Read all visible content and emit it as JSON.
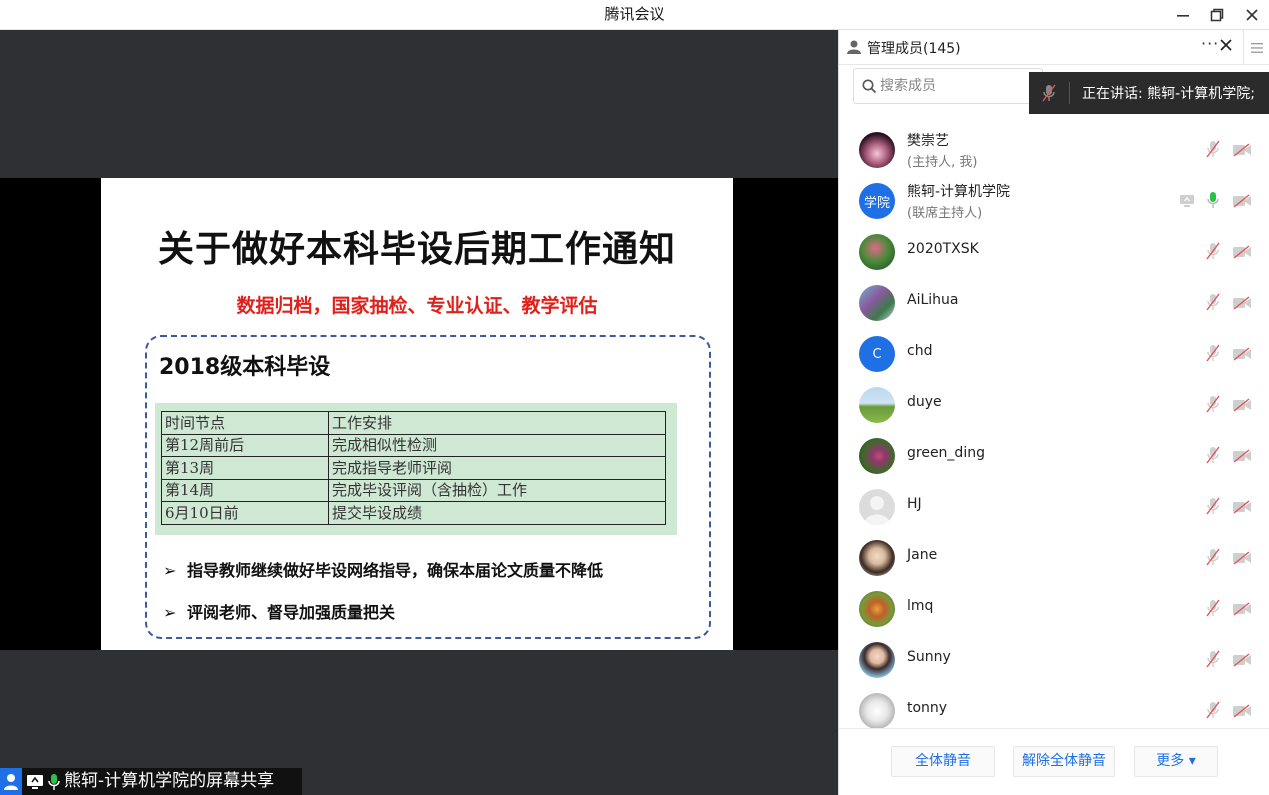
{
  "window": {
    "title": "腾讯会议"
  },
  "slide": {
    "title": "关于做好本科毕设后期工作通知",
    "subtitle": "数据归档，国家抽检、专业认证、教学评估",
    "box_title": "2018级本科毕设",
    "table": {
      "headers": [
        "时间节点",
        "工作安排"
      ],
      "rows": [
        [
          "第12周前后",
          "完成相似性检测"
        ],
        [
          "第13周",
          "完成指导老师评阅"
        ],
        [
          "第14周",
          "完成毕设评阅（含抽检）工作"
        ],
        [
          "6月10日前",
          "提交毕设成绩"
        ]
      ]
    },
    "bullets": [
      "指导教师继续做好毕设网络指导，确保本届论文质量不降低",
      "评阅老师、督导加强质量把关"
    ],
    "bullet_symbol": "➢"
  },
  "share": {
    "label": "熊轲-计算机学院的屏幕共享"
  },
  "panel": {
    "title": "管理成员(145)",
    "more_label": "···",
    "search_placeholder": "搜索成员",
    "speaking": "正在讲话: 熊轲-计算机学院;",
    "members": [
      {
        "name": "樊崇艺",
        "role": "(主持人, 我)",
        "avatar": "photo",
        "mic": "muted",
        "cam": "off"
      },
      {
        "name": "熊轲-计算机学院",
        "role": "(联席主持人)",
        "avatar": "text",
        "avatar_text": "学院",
        "mic": "on",
        "cam": "off",
        "sharing": true
      },
      {
        "name": "2020TXSK",
        "role": "",
        "avatar": "photo",
        "mic": "muted",
        "cam": "off"
      },
      {
        "name": "AiLihua",
        "role": "",
        "avatar": "photo",
        "mic": "muted",
        "cam": "off"
      },
      {
        "name": "chd",
        "role": "",
        "avatar": "text",
        "avatar_text": "C",
        "mic": "muted",
        "cam": "off"
      },
      {
        "name": "duye",
        "role": "",
        "avatar": "photo",
        "mic": "muted",
        "cam": "off"
      },
      {
        "name": "green_ding",
        "role": "",
        "avatar": "photo",
        "mic": "muted",
        "cam": "off"
      },
      {
        "name": "HJ",
        "role": "",
        "avatar": "default",
        "mic": "muted",
        "cam": "off"
      },
      {
        "name": "Jane",
        "role": "",
        "avatar": "photo",
        "mic": "muted",
        "cam": "off"
      },
      {
        "name": "lmq",
        "role": "",
        "avatar": "photo",
        "mic": "muted",
        "cam": "off"
      },
      {
        "name": "Sunny",
        "role": "",
        "avatar": "photo",
        "mic": "muted",
        "cam": "off"
      },
      {
        "name": "tonny",
        "role": "",
        "avatar": "photo",
        "mic": "muted",
        "cam": "off"
      }
    ],
    "footer": {
      "mute_all": "全体静音",
      "unmute_all": "解除全体静音",
      "more": "更多 ▾"
    }
  },
  "colors": {
    "accent": "#1f6fe5",
    "mic_on": "#2bc04a",
    "muted_red": "#e05555"
  }
}
